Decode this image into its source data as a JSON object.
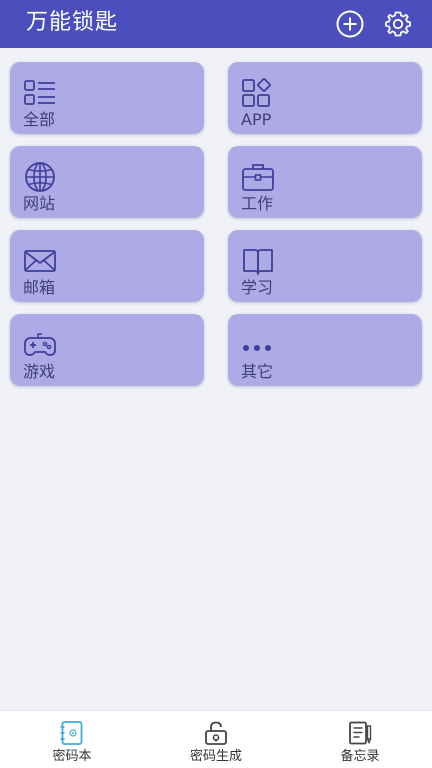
{
  "header": {
    "title": "万能锁匙",
    "add_icon": "plus-circle-icon",
    "settings_icon": "gear-icon"
  },
  "categories": [
    {
      "label": "全部",
      "icon": "list-icon"
    },
    {
      "label": "APP",
      "icon": "apps-icon"
    },
    {
      "label": "网站",
      "icon": "globe-icon"
    },
    {
      "label": "工作",
      "icon": "briefcase-icon"
    },
    {
      "label": "邮箱",
      "icon": "envelope-icon"
    },
    {
      "label": "学习",
      "icon": "book-icon"
    },
    {
      "label": "游戏",
      "icon": "gamepad-icon"
    },
    {
      "label": "其它",
      "icon": "more-dots-icon"
    }
  ],
  "bottom_nav": [
    {
      "label": "密码本",
      "icon": "password-book-icon",
      "active": true
    },
    {
      "label": "密码生成",
      "icon": "lock-icon",
      "active": false
    },
    {
      "label": "备忘录",
      "icon": "memo-icon",
      "active": false
    }
  ],
  "colors": {
    "header_bg": "#4b4fbd",
    "card_bg": "#aeaae6",
    "card_icon": "#3d3f9a",
    "page_bg": "#f0f2f7",
    "nav_active": "#3db0d6"
  }
}
